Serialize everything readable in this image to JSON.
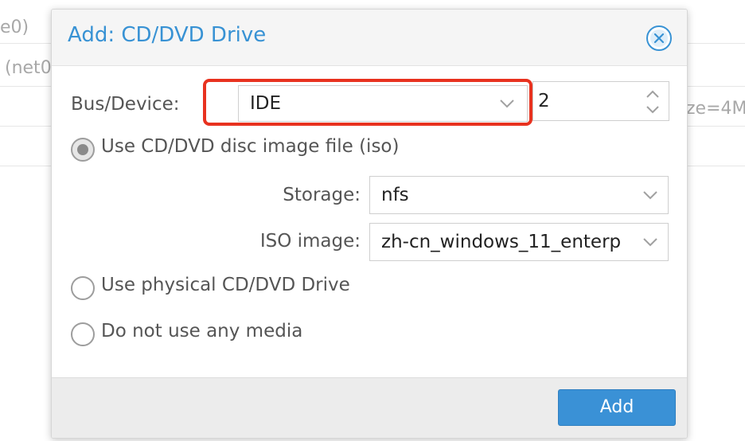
{
  "background": {
    "rows": [
      {
        "text": "e0)"
      },
      {
        "text": "(net0"
      },
      {
        "text": "ze=4M"
      }
    ]
  },
  "dialog": {
    "title": "Add: CD/DVD Drive",
    "close_icon": "close-circle-icon",
    "bus_device": {
      "label": "Bus/Device:",
      "bus_value": "IDE",
      "device_value": "2"
    },
    "options": {
      "iso": {
        "label": "Use CD/DVD disc image file (iso)",
        "checked": true
      },
      "storage": {
        "label": "Storage:",
        "value": "nfs"
      },
      "iso_image": {
        "label": "ISO image:",
        "value": "zh-cn_windows_11_enterp"
      },
      "physical": {
        "label": "Use physical CD/DVD Drive",
        "checked": false
      },
      "none": {
        "label": "Do not use any media",
        "checked": false
      }
    },
    "footer": {
      "add_label": "Add"
    }
  },
  "colors": {
    "accent": "#3892d4",
    "button": "#3a91d6",
    "highlight": "#e8321f"
  }
}
